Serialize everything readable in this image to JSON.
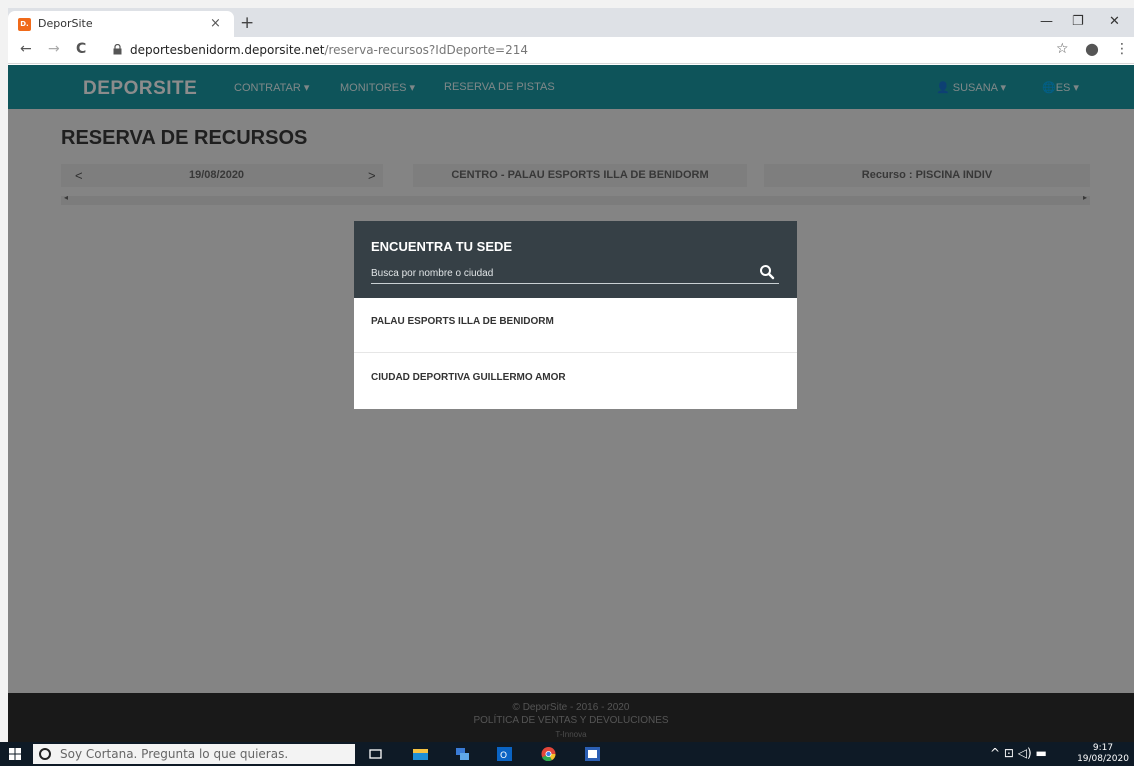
{
  "browser": {
    "tab_title": "DeporSite",
    "tab_close": "×",
    "new_tab": "+",
    "favicon_text": "D.",
    "url_host": "deportesbenidorm.deporsite.net",
    "url_path": "/reserva-recursos?IdDeporte=214",
    "window_controls": {
      "minimize": "—",
      "maximize": "❐",
      "close": "✕"
    },
    "nav": {
      "back": "←",
      "forward": "→",
      "reload": "C"
    },
    "toolbar_icons": {
      "bookmark": "☆",
      "profile": "●",
      "menu": "⋮"
    }
  },
  "site": {
    "brand": "DEPORSITE",
    "nav_links": [
      "CONTRATAR ▾",
      "MONITORES ▾",
      "RESERVA DE PISTAS"
    ],
    "user_menu": "SUSANA ▾",
    "lang_menu": "ES ▾"
  },
  "page": {
    "title": "RESERVA DE RECURSOS",
    "date_prev": "<",
    "date": "19/08/2020",
    "date_next": ">",
    "centro": "CENTRO - PALAU ESPORTS ILLA DE BENIDORM",
    "recurso": "Recurso : PISCINA INDIV"
  },
  "modal": {
    "title": "ENCUENTRA TU SEDE",
    "search_placeholder": "Busca por nombre o ciudad",
    "venues": [
      "PALAU ESPORTS ILLA DE BENIDORM",
      "CIUDAD DEPORTIVA GUILLERMO AMOR"
    ]
  },
  "footer": {
    "copyright": "© DeporSite - 2016 - 2020",
    "policy": "POLÍTICA DE VENTAS Y DEVOLUCIONES",
    "credit": "T-Innova"
  },
  "taskbar": {
    "search_placeholder": "Soy Cortana. Pregunta lo que quieras.",
    "tray_icons": "^ ⊡ ◁) ▬",
    "time": "9:17",
    "date": "19/08/2020"
  }
}
